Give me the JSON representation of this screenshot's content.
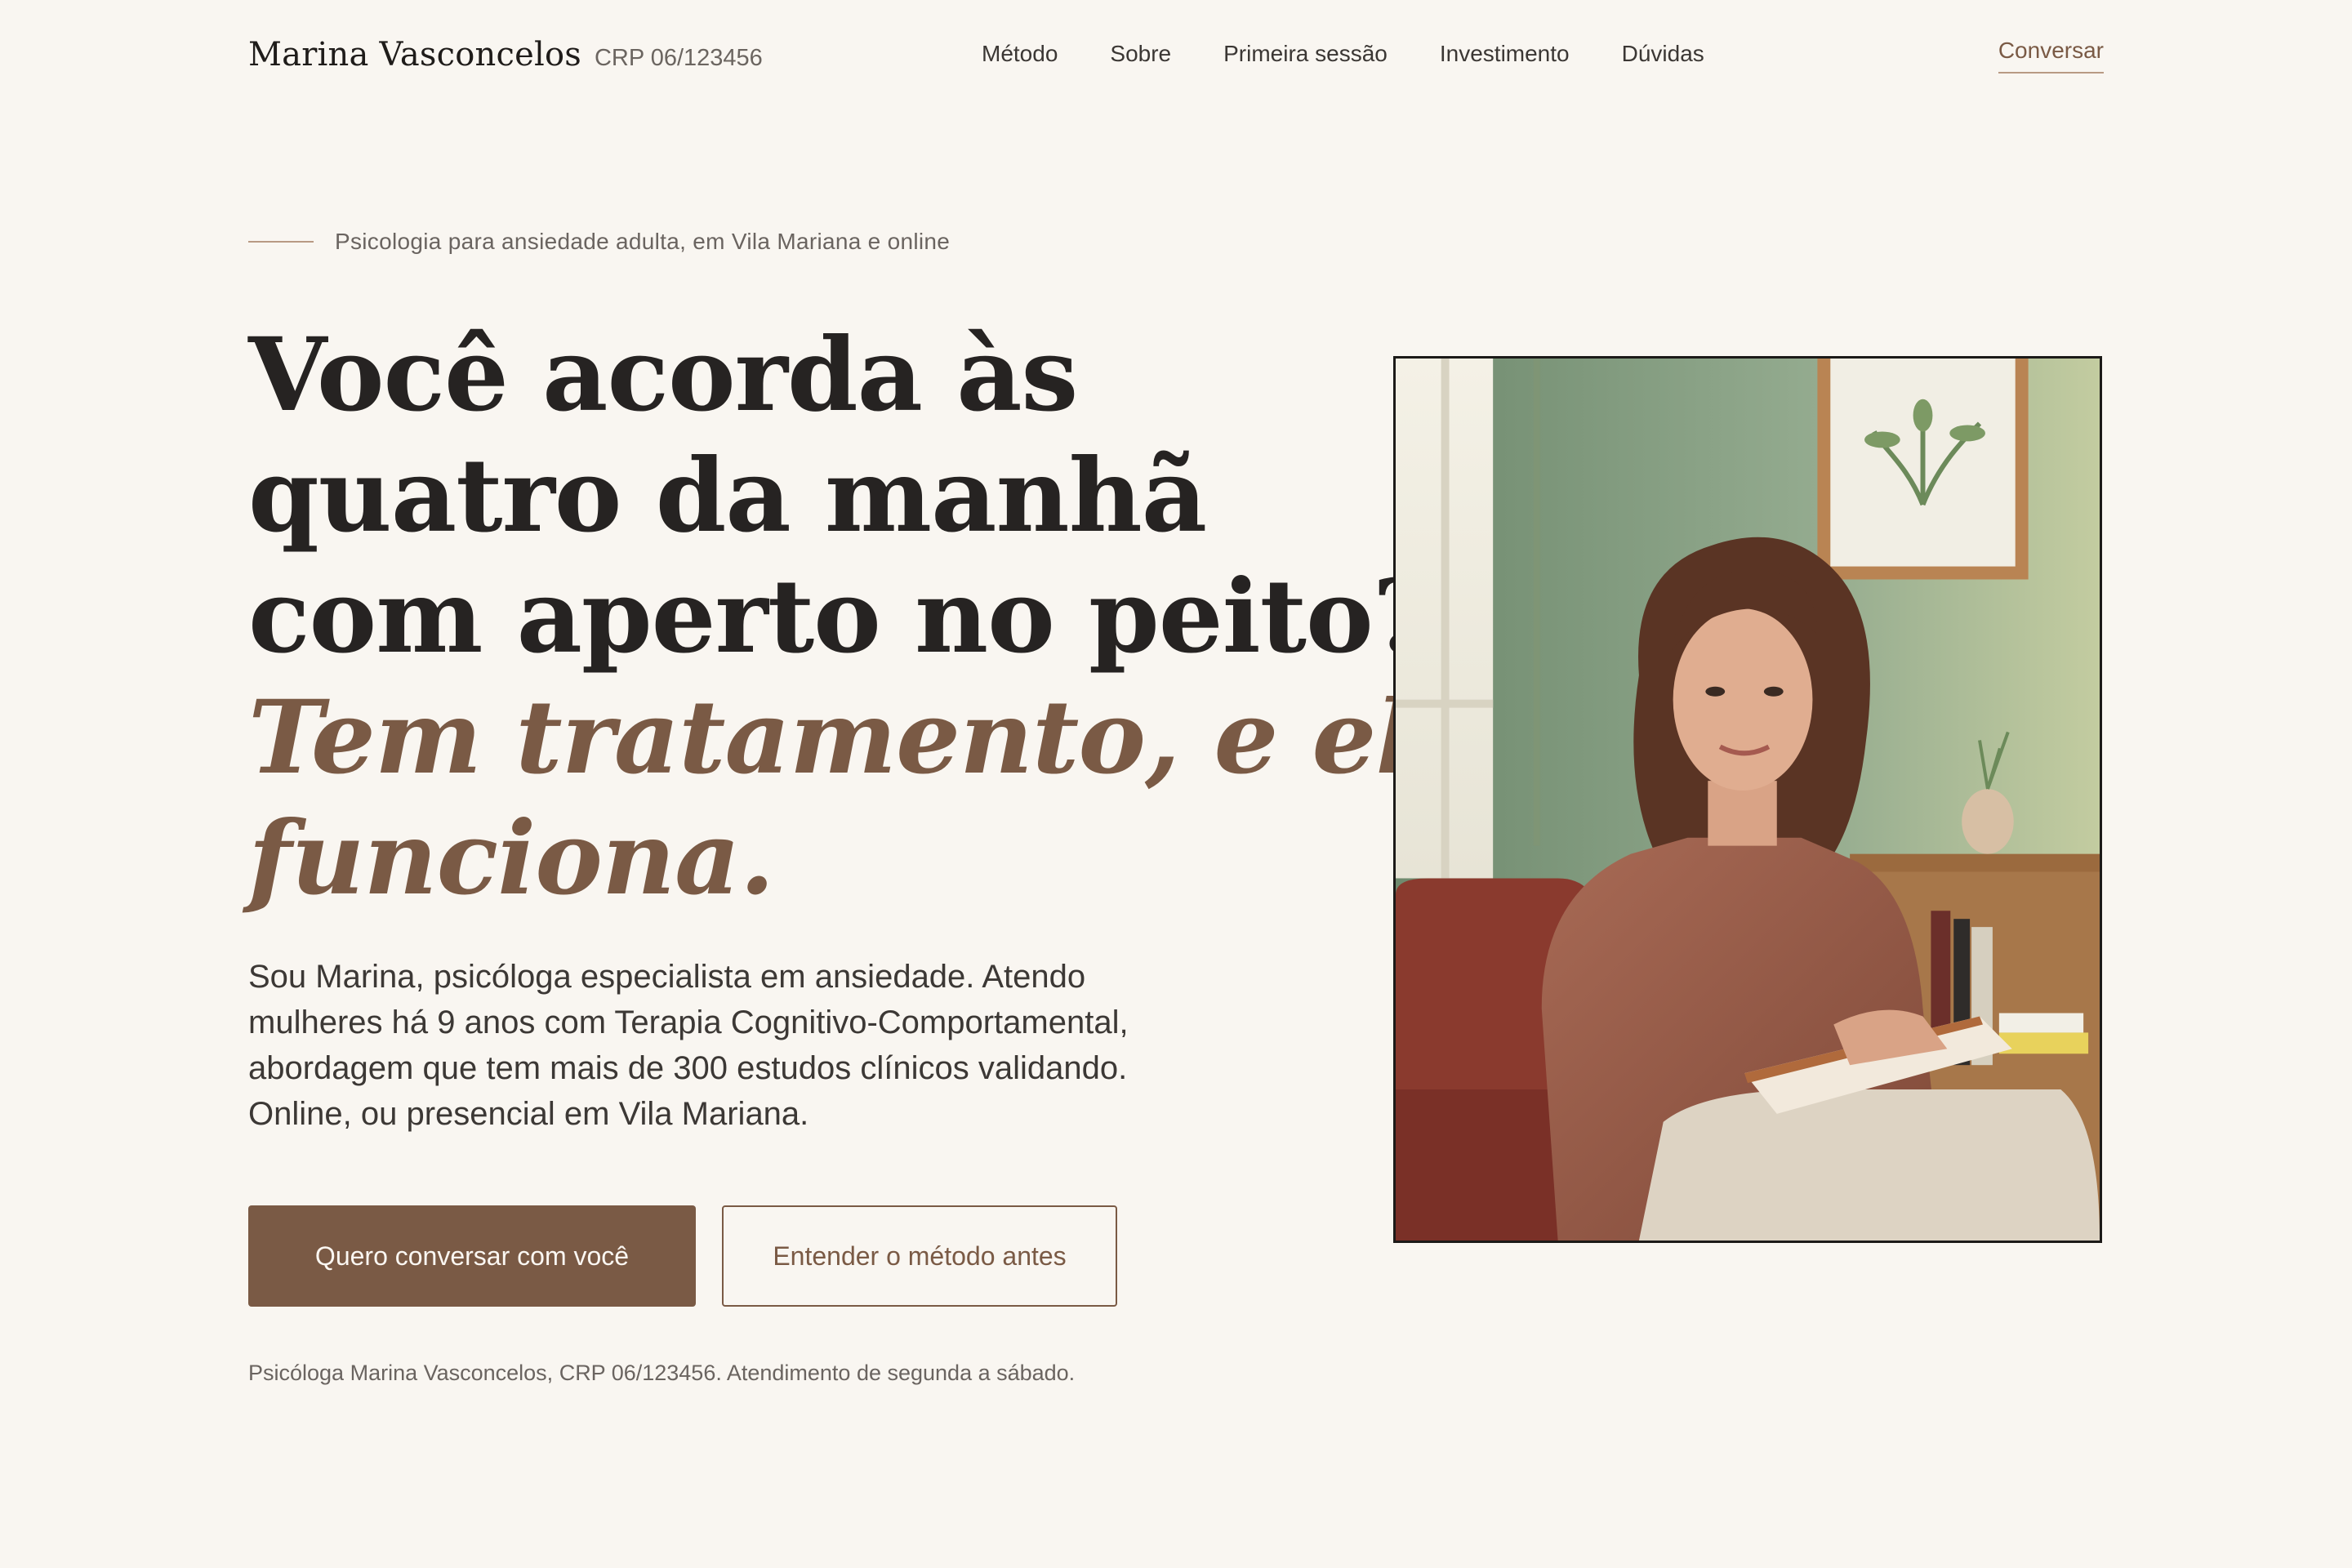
{
  "header": {
    "brand_name": "Marina Vasconcelos",
    "brand_crp": "CRP 06/123456",
    "nav": [
      "Método",
      "Sobre",
      "Primeira sessão",
      "Investimento",
      "Dúvidas"
    ],
    "cta": "Conversar"
  },
  "hero": {
    "eyebrow": "Psicologia para ansiedade adulta, em Vila Mariana e online",
    "headline_lines": [
      "Você acorda às",
      "quatro da manhã",
      "com aperto no peito?"
    ],
    "headline_accent_lines": [
      "Tem tratamento, e ele",
      "funciona."
    ],
    "lede": "Sou Marina, psicóloga especialista em ansiedade. Atendo mulheres há 9 anos com Terapia Cognitivo-Comportamental, abordagem que tem mais de 300 estudos clínicos validando. Online, ou presencial em Vila Mariana.",
    "primary_button": "Quero conversar com você",
    "secondary_button": "Entender o método antes",
    "footnote": "Psicóloga Marina Vasconcelos, CRP 06/123456. Atendimento de segunda a sábado."
  },
  "colors": {
    "background": "#f9f6f1",
    "accent": "#7a5a45",
    "text": "#262322"
  }
}
